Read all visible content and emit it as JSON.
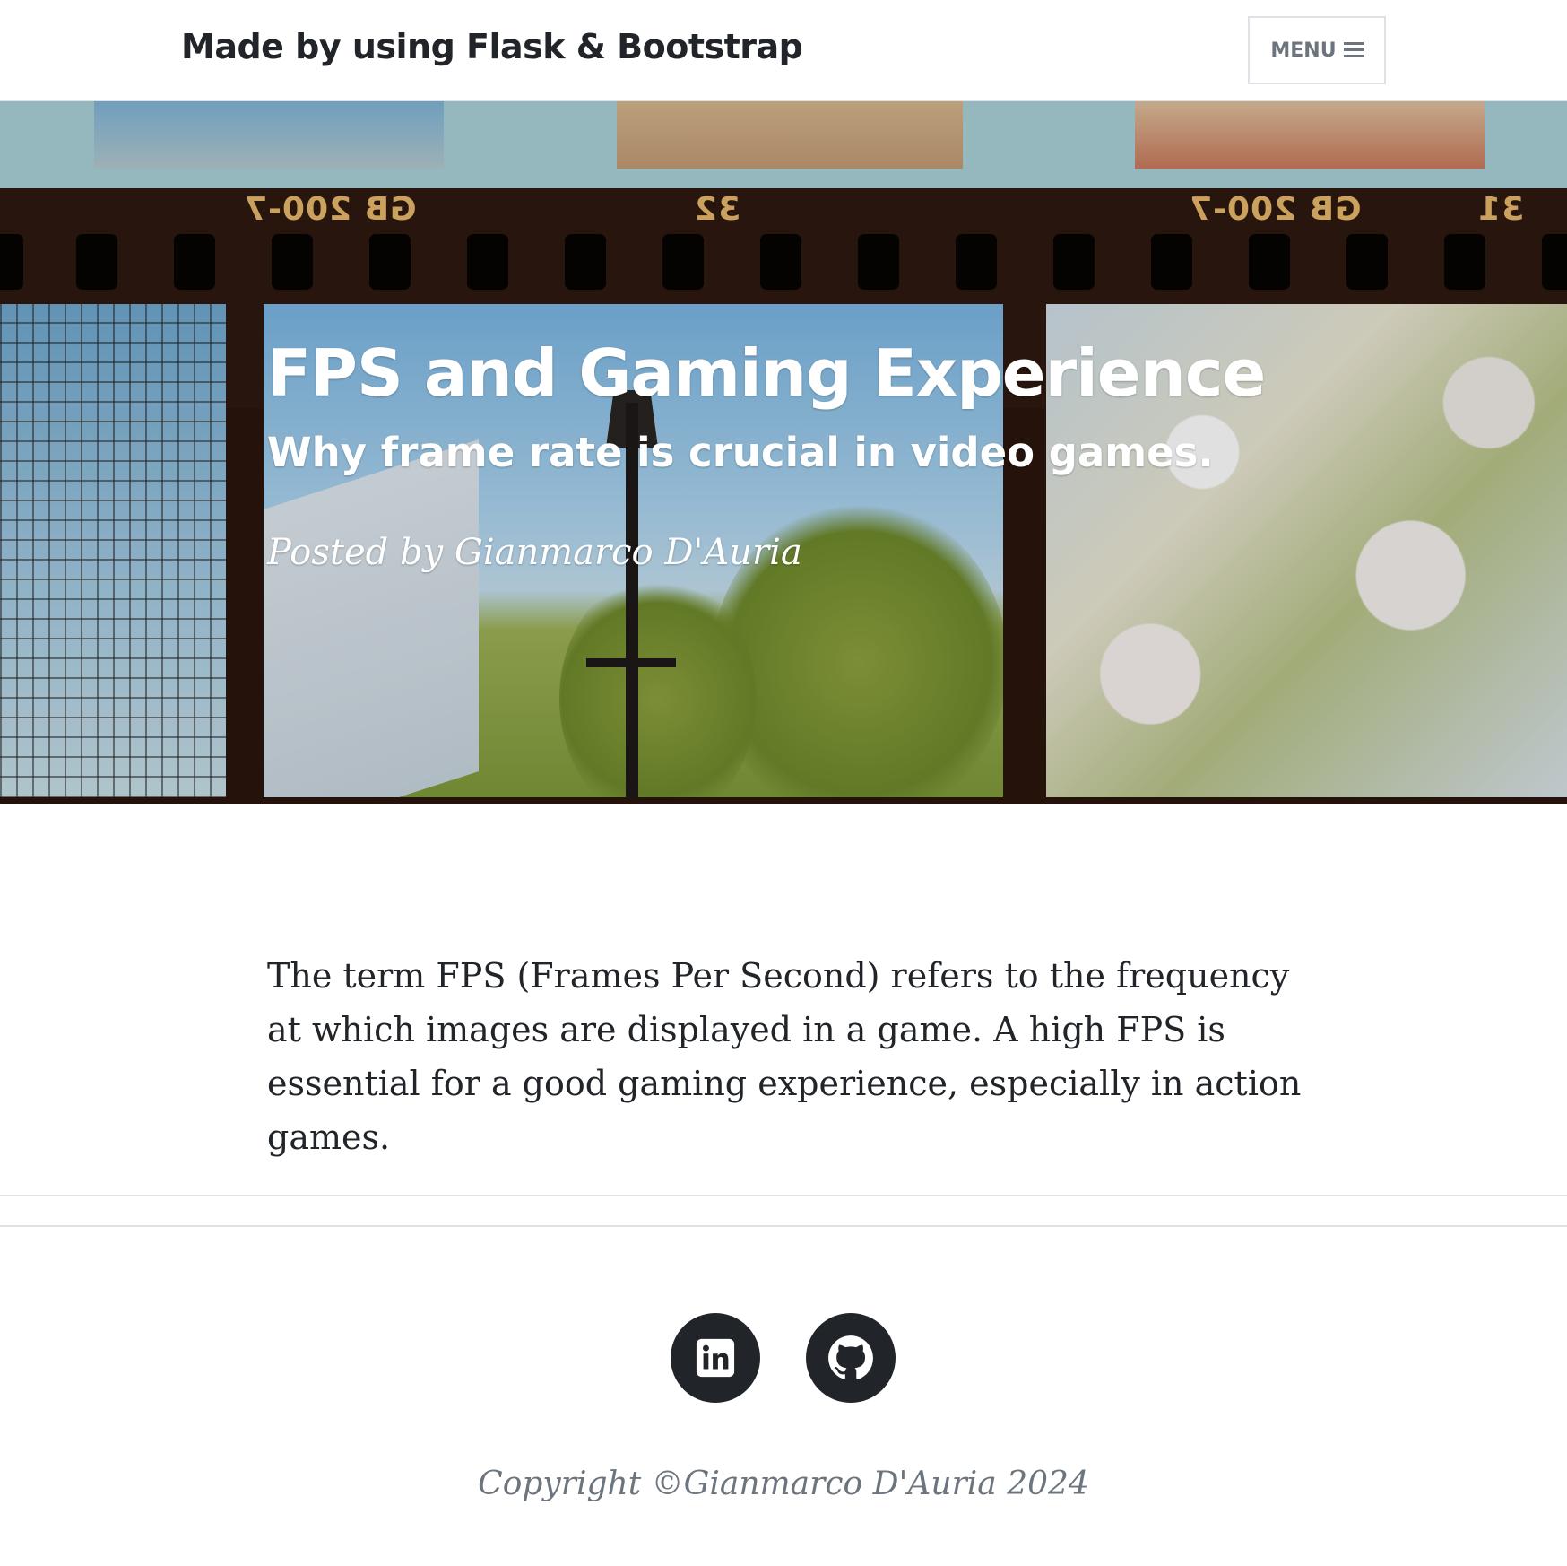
{
  "navbar": {
    "brand": "Made by using Flask & Bootstrap",
    "menu_label": "MENU",
    "menu_icon": "bars-icon"
  },
  "header": {
    "title": "FPS and Gaming Experience",
    "subtitle": "Why frame rate is crucial in video games.",
    "meta": "Posted by Gianmarco D'Auria",
    "background_image": "film-strip-photo",
    "film_codes": [
      "GB 200-7",
      "32",
      "GB 200-7",
      "31"
    ]
  },
  "article": {
    "body": "The term FPS (Frames Per Second) refers to the frequency at which images are displayed in a game. A high FPS is essential for a good gaming experience, especially in action games."
  },
  "footer": {
    "social": [
      {
        "name": "linkedin",
        "icon": "linkedin-icon"
      },
      {
        "name": "github",
        "icon": "github-icon"
      }
    ],
    "copyright": "Copyright ©Gianmarco D'Auria 2024"
  },
  "colors": {
    "text_dark": "#212529",
    "text_muted": "#6c757d",
    "border": "#dee2e6",
    "social_bg": "#212529"
  }
}
